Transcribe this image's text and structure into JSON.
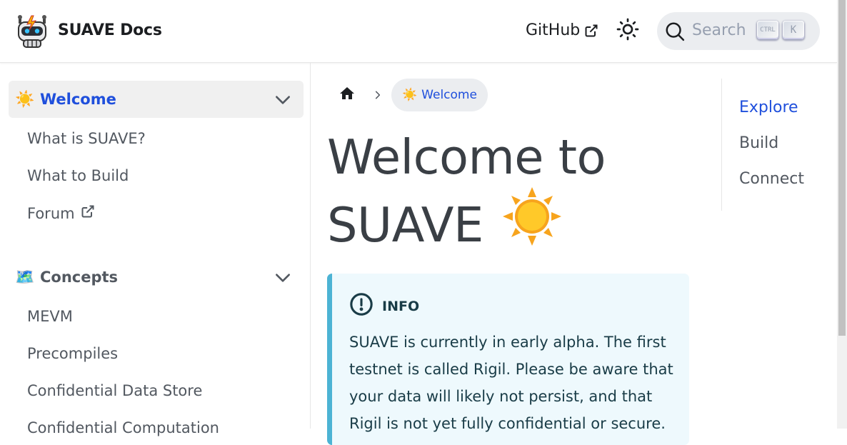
{
  "navbar": {
    "title": "SUAVE Docs",
    "logo_icon": "robot-logo",
    "github_label": "GitHub",
    "theme_icon": "sun-icon",
    "search": {
      "label": "Search",
      "shortcut_ctrl": "CTRL",
      "shortcut_key": "K"
    }
  },
  "sidebar": {
    "categories": [
      {
        "emoji": "☀️",
        "label": "Welcome",
        "active": true,
        "items": [
          {
            "label": "What is SUAVE?"
          },
          {
            "label": "What to Build"
          },
          {
            "label": "Forum",
            "external": true
          }
        ]
      },
      {
        "emoji": "🗺️",
        "label": "Concepts",
        "active": false,
        "items": [
          {
            "label": "MEVM"
          },
          {
            "label": "Precompiles"
          },
          {
            "label": "Confidential Data Store"
          },
          {
            "label": "Confidential Computation"
          }
        ]
      }
    ]
  },
  "breadcrumbs": {
    "home_icon": "home-icon",
    "current_emoji": "☀️",
    "current_label": "Welcome"
  },
  "main": {
    "title_line1": "Welcome to",
    "title_line2": "SUAVE",
    "title_emoji": "☀️",
    "admonition": {
      "type": "INFO",
      "icon": "info-circle-icon",
      "text": "SUAVE is currently in early alpha. The first testnet is called Rigil. Please be aware that your data will likely not persist, and that Rigil is not yet fully confidential or secure."
    }
  },
  "toc": {
    "items": [
      {
        "label": "Explore",
        "active": true
      },
      {
        "label": "Build",
        "active": false
      },
      {
        "label": "Connect",
        "active": false
      }
    ]
  },
  "colors": {
    "accent": "#1f4fdc",
    "info_border": "#4cb3d4",
    "info_bg": "#eef9fd",
    "text_muted": "#525860"
  }
}
